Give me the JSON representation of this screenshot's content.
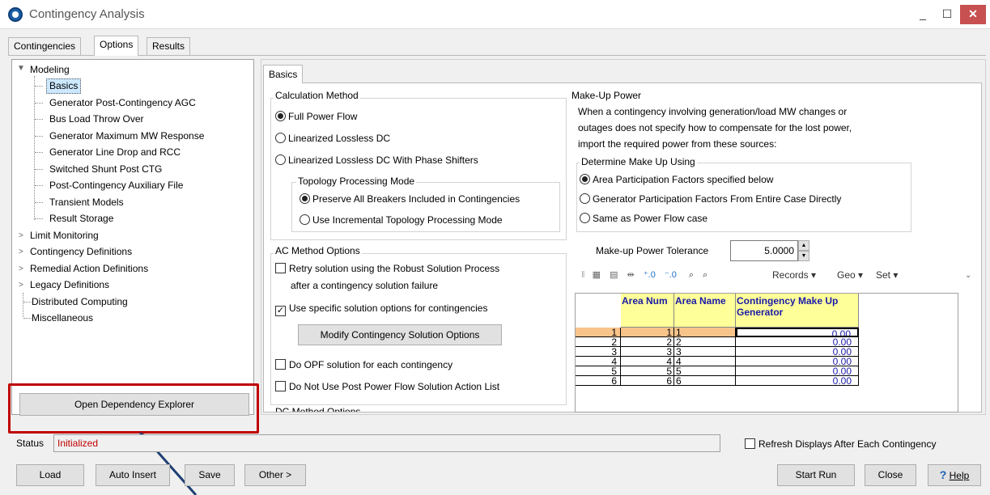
{
  "window": {
    "title": "Contingency Analysis",
    "minimize": "_",
    "maximize": "☐",
    "close": "✕"
  },
  "tabs": [
    "Contingencies",
    "Options",
    "Results"
  ],
  "tree": {
    "modeling": "Modeling",
    "children": [
      "Basics",
      "Generator Post-Contingency AGC",
      "Bus Load Throw Over",
      "Generator Maximum MW Response",
      "Generator Line Drop and RCC",
      "Switched Shunt Post CTG",
      "Post-Contingency Auxiliary File",
      "Transient Models",
      "Result Storage"
    ],
    "others": [
      "Limit Monitoring",
      "Contingency Definitions",
      "Remedial Action Definitions",
      "Legacy Definitions"
    ],
    "leaves": [
      "Distributed Computing",
      "Miscellaneous"
    ]
  },
  "dependency_button": "Open Dependency Explorer",
  "basics_tab": "Basics",
  "calc": {
    "title": "Calculation Method",
    "options": [
      "Full Power Flow",
      "Linearized Lossless DC",
      "Linearized Lossless DC With Phase Shifters"
    ],
    "topology_title": "Topology Processing Mode",
    "topology_options": [
      "Preserve All Breakers Included in Contingencies",
      "Use Incremental Topology Processing Mode"
    ]
  },
  "ac": {
    "title": "AC Method Options",
    "retry_line1": "Retry solution using the Robust Solution Process",
    "retry_line2": "after a contingency solution failure",
    "use_specific": "Use specific solution options for contingencies",
    "modify_button": "Modify Contingency Solution Options",
    "opf": "Do OPF solution for each contingency",
    "no_post": "Do Not Use Post Power Flow Solution Action List"
  },
  "dc": {
    "title": "DC Method Options"
  },
  "makeup": {
    "title": "Make-Up Power",
    "desc": [
      "When a contingency involving generation/load MW changes or",
      "outages  does not specify how to compensate for the lost power,",
      "import the required power from these sources:"
    ],
    "determine_title": "Determine Make Up Using",
    "options": [
      "Area Participation Factors specified below",
      "Generator Participation Factors From Entire Case Directly",
      "Same as Power Flow case"
    ],
    "tolerance_label": "Make-up Power Tolerance",
    "tolerance_value": "5.0000"
  },
  "toolbar": {
    "records": "Records ▾",
    "geo": "Geo ▾",
    "set": "Set ▾"
  },
  "grid": {
    "headers": [
      "Area Num",
      "Area Name",
      "Contingency Make Up Generator"
    ],
    "rows": [
      {
        "idx": "1",
        "num": "1",
        "name": "1",
        "val": "0.00"
      },
      {
        "idx": "2",
        "num": "2",
        "name": "2",
        "val": "0.00"
      },
      {
        "idx": "3",
        "num": "3",
        "name": "3",
        "val": "0.00"
      },
      {
        "idx": "4",
        "num": "4",
        "name": "4",
        "val": "0.00"
      },
      {
        "idx": "5",
        "num": "5",
        "name": "5",
        "val": "0.00"
      },
      {
        "idx": "6",
        "num": "6",
        "name": "6",
        "val": "0.00"
      }
    ]
  },
  "status": {
    "label": "Status",
    "value": "Initialized",
    "refresh": "Refresh Displays After Each Contingency"
  },
  "buttons": {
    "load": "Load",
    "auto_insert": "Auto Insert",
    "save": "Save",
    "other": "Other >",
    "start_run": "Start Run",
    "close": "Close",
    "help": "Help"
  },
  "colors": {
    "accent": "#c00000",
    "grid_header": "#ffff99",
    "selected_row": "#f8c48a",
    "value_text": "#1a1aa8"
  }
}
